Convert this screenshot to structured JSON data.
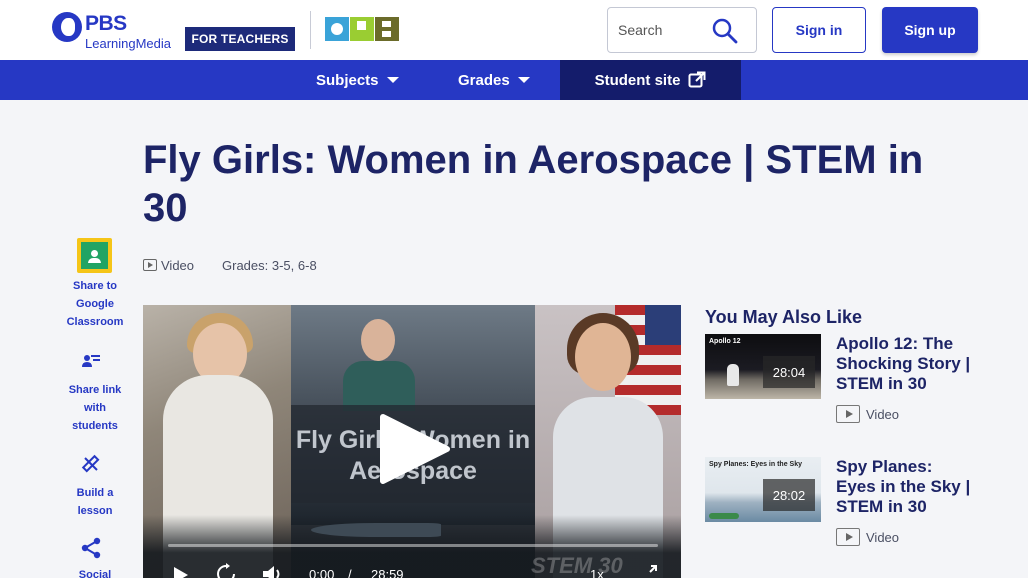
{
  "header": {
    "brand": "PBS",
    "brand_sub": "LearningMedia",
    "audience_badge": "FOR TEACHERS",
    "partner_logo": "OPB",
    "search_placeholder": "Search",
    "sign_in_label": "Sign in",
    "sign_up_label": "Sign up"
  },
  "nav": {
    "subjects_label": "Subjects",
    "grades_label": "Grades",
    "student_site_label": "Student site"
  },
  "page": {
    "title": "Fly Girls: Women in Aerospace | STEM in 30",
    "media_type": "Video",
    "grades": "Grades: 3-5, 6-8"
  },
  "rail": {
    "google_classroom": "Share to Google Classroom",
    "share_link": "Share link with students",
    "build_lesson": "Build a lesson",
    "social": "Social"
  },
  "video": {
    "overlay_title": "Fly Girls: Women in Aerospace",
    "watermark": "STEM 30",
    "current_time": "0:00",
    "duration": "28:59",
    "speed": "1x",
    "progress": 0
  },
  "recommendations": {
    "heading": "You May Also Like",
    "items": [
      {
        "title": "Apollo 12: The Shocking Story | STEM in 30",
        "duration": "28:04",
        "type": "Video",
        "thumb_caption": "Apollo 12"
      },
      {
        "title": "Spy Planes: Eyes in the Sky | STEM in 30",
        "duration": "28:02",
        "type": "Video",
        "thumb_caption": "Spy Planes: Eyes in the Sky"
      }
    ]
  },
  "colors": {
    "brand_blue": "#2638c4",
    "dark_navy": "#1d2466",
    "student_site_bg": "#141c6b",
    "page_bg": "#f4f5f8"
  },
  "icons": [
    "search-icon",
    "chevron-down-icon",
    "external-link-icon",
    "google-classroom-icon",
    "share-link-icon",
    "build-lesson-icon",
    "social-share-icon",
    "play-icon",
    "video-type-icon",
    "replay-icon",
    "volume-icon",
    "fullscreen-icon"
  ]
}
